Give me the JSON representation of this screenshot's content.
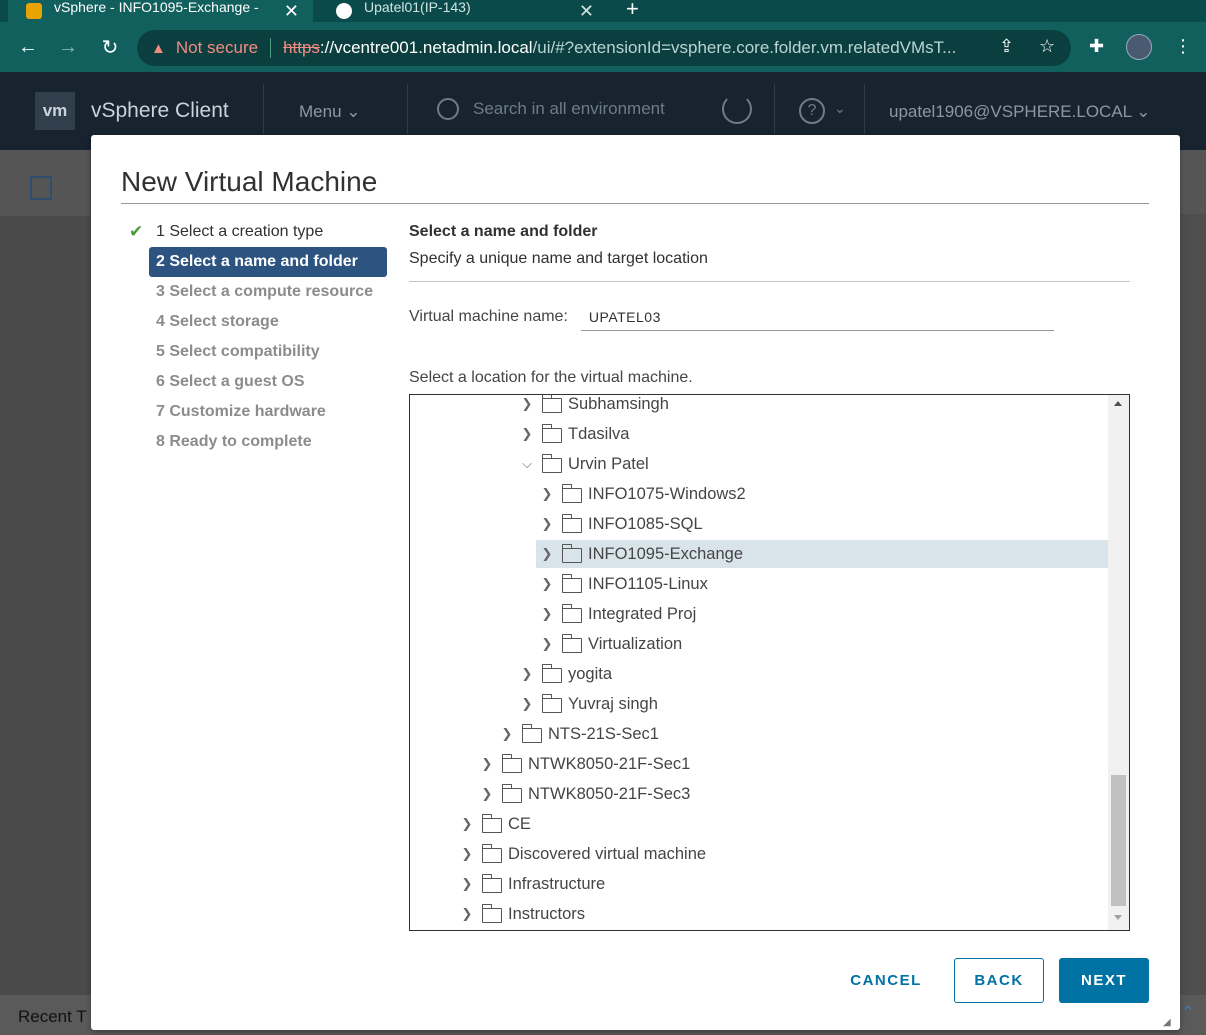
{
  "browser": {
    "tabs": [
      {
        "title": "vSphere - INFO1095-Exchange -",
        "active": true
      },
      {
        "title": "Upatel01(IP-143)",
        "active": false
      }
    ],
    "url": {
      "security_label": "Not secure",
      "scheme": "https",
      "host": "://vcentre001.netadmin.local",
      "path": "/ui/#?extensionId=vsphere.core.folder.vm.relatedVMsT..."
    }
  },
  "app": {
    "logo": "vm",
    "title": "vSphere Client",
    "menu_label": "Menu",
    "search_placeholder": "Search in all environment",
    "user": "upatel1906@VSPHERE.LOCAL",
    "recent_tasks_label": "Recent T"
  },
  "dialog": {
    "title": "New Virtual Machine",
    "steps": [
      {
        "label": "1 Select a creation type",
        "state": "done"
      },
      {
        "label": "2 Select a name and folder",
        "state": "current"
      },
      {
        "label": "3 Select a compute resource",
        "state": "pending"
      },
      {
        "label": "4 Select storage",
        "state": "pending"
      },
      {
        "label": "5 Select compatibility",
        "state": "pending"
      },
      {
        "label": "6 Select a guest OS",
        "state": "pending"
      },
      {
        "label": "7 Customize hardware",
        "state": "pending"
      },
      {
        "label": "8 Ready to complete",
        "state": "pending"
      }
    ],
    "section_title": "Select a name and folder",
    "section_subtitle": "Specify a unique name and target location",
    "vm_name_label": "Virtual machine name:",
    "vm_name_value": "UPATEL03",
    "location_label": "Select a location for the virtual machine.",
    "tree": [
      {
        "label": "Subhamsingh",
        "depth": 5,
        "expanded": false
      },
      {
        "label": "Tdasilva",
        "depth": 5,
        "expanded": false
      },
      {
        "label": "Urvin Patel",
        "depth": 5,
        "expanded": true
      },
      {
        "label": "INFO1075-Windows2",
        "depth": 6,
        "expanded": false
      },
      {
        "label": "INFO1085-SQL",
        "depth": 6,
        "expanded": false
      },
      {
        "label": "INFO1095-Exchange",
        "depth": 6,
        "expanded": false,
        "selected": true
      },
      {
        "label": "INFO1105-Linux",
        "depth": 6,
        "expanded": false
      },
      {
        "label": "Integrated Proj",
        "depth": 6,
        "expanded": false
      },
      {
        "label": "Virtualization",
        "depth": 6,
        "expanded": false
      },
      {
        "label": "yogita",
        "depth": 5,
        "expanded": false
      },
      {
        "label": "Yuvraj singh",
        "depth": 5,
        "expanded": false
      },
      {
        "label": "NTS-21S-Sec1",
        "depth": 4,
        "expanded": false
      },
      {
        "label": "NTWK8050-21F-Sec1",
        "depth": 3,
        "expanded": false
      },
      {
        "label": "NTWK8050-21F-Sec3",
        "depth": 3,
        "expanded": false
      },
      {
        "label": "CE",
        "depth": 2,
        "expanded": false
      },
      {
        "label": "Discovered virtual machine",
        "depth": 2,
        "expanded": false
      },
      {
        "label": "Infrastructure",
        "depth": 2,
        "expanded": false
      },
      {
        "label": "Instructors",
        "depth": 2,
        "expanded": false
      }
    ],
    "buttons": {
      "cancel": "CANCEL",
      "back": "BACK",
      "next": "NEXT"
    }
  },
  "colors": {
    "browser_toolbar": "#11605e",
    "vsphere_header": "#17232e",
    "current_step": "#2d5480",
    "primary_button": "#0072a3",
    "selected_row": "#d9e4ea",
    "done_check": "#4a9a3a"
  }
}
